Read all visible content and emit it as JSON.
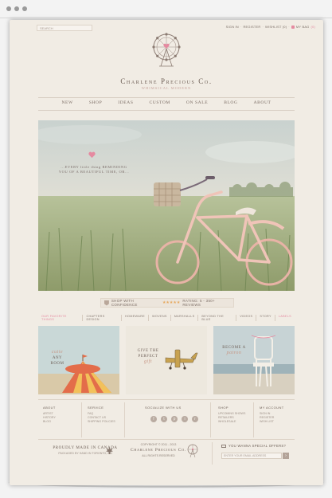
{
  "header": {
    "search_placeholder": "SEARCH",
    "account_links": [
      "SIGN IN",
      "REGISTER",
      "WISHLIST (0)"
    ],
    "cart_label": "MY BAG",
    "cart_count": "(0)"
  },
  "brand": {
    "name": "Charlene Precious Co.",
    "tagline": "WHIMSICAL MODERN"
  },
  "nav": {
    "items": [
      "NEW",
      "SHOP",
      "IDEAS",
      "CUSTOM",
      "ON SALE",
      "BLOG",
      "ABOUT"
    ]
  },
  "hero": {
    "text": "...EVERY little thing REMINDING YOU OF A BEAUTIFUL TIME, OR..."
  },
  "confidence": {
    "label": "SHOP WITH CONFIDENCE",
    "stars": "★★★★★",
    "rating": "RATING: 5 - 350+ REVIEWS"
  },
  "subnav": {
    "items": [
      "OUR FAVORITE THINGS",
      "CHAPTERS DESIGN",
      "HOMEWARE",
      "WOVENS",
      "MARSHALLS",
      "BEYOND THE BLUE",
      "VIDEOS",
      "STORY",
      "LABELS"
    ]
  },
  "tiles": [
    {
      "line1": "cutie",
      "line2": "ANY",
      "line3": "ROOM"
    },
    {
      "line1": "GIVE THE",
      "line2": "PERFECT",
      "line3": "gift"
    },
    {
      "line1": "BECOME A",
      "line2": "patron"
    }
  ],
  "footer": {
    "about": {
      "title": "ABOUT",
      "links": [
        "ARTIST",
        "HISTORY",
        "BLOG"
      ]
    },
    "service": {
      "title": "SERVICE",
      "links": [
        "FAQ",
        "CONTACT US",
        "SHIPPING POLICIES"
      ]
    },
    "socialize_title": "SOCIALIZE WITH US",
    "social_icons": [
      "f",
      "t",
      "p",
      "i",
      "r"
    ],
    "shop": {
      "title": "SHOP",
      "links": [
        "UPCOMING SHOWS",
        "RETAILERS",
        "WHOLESALE"
      ]
    },
    "my_account": {
      "title": "MY ACCOUNT",
      "links": [
        "SIGN IN",
        "REGISTER",
        "WISH LIST"
      ]
    },
    "proudly": "PROUDLY MADE IN CANADA",
    "proudly_sub": "PACKAGED BY HAND IN TORONTO, ON",
    "copyright_line": "COPYRIGHT © 2011 - 2013",
    "copyright_brand": "Charlene Precious Co.",
    "rights": "ALL RIGHTS RESERVED",
    "offers_title": "YOU WANNA SPECIAL OFFERS?",
    "offers_placeholder": "ENTER YOUR EMAIL ADDRESS",
    "offers_go": "›"
  },
  "colors": {
    "accent_pink": "#e58aa0",
    "page_bg": "#f1ece4",
    "text_brown": "#6d5e55"
  }
}
